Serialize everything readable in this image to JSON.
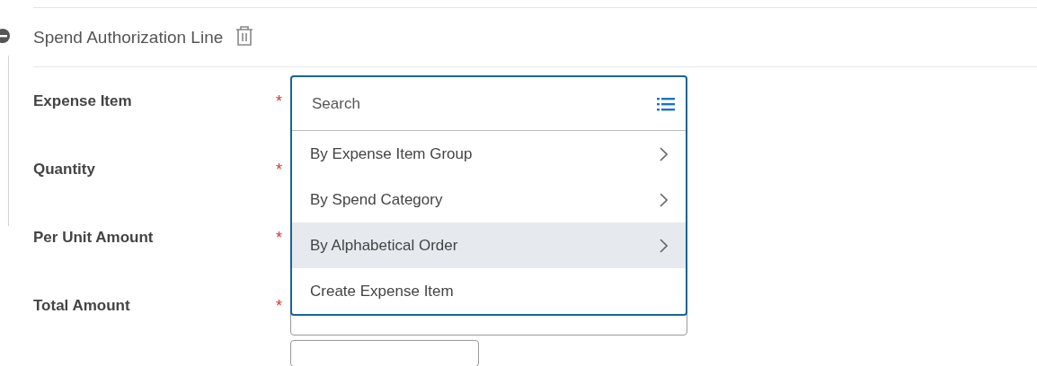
{
  "section": {
    "title": "Spend Authorization Line"
  },
  "fields": [
    {
      "label": "Expense Item",
      "required_mark": "*"
    },
    {
      "label": "Quantity",
      "required_mark": "*"
    },
    {
      "label": "Per Unit Amount",
      "required_mark": "*"
    },
    {
      "label": "Total Amount",
      "required_mark": "*"
    }
  ],
  "dropdown": {
    "placeholder": "Search",
    "options": [
      {
        "label": "By Expense Item Group",
        "has_submenu": true,
        "selected": false
      },
      {
        "label": "By Spend Category",
        "has_submenu": true,
        "selected": false
      },
      {
        "label": "By Alphabetical Order",
        "has_submenu": true,
        "selected": true
      },
      {
        "label": "Create Expense Item",
        "has_submenu": false,
        "selected": false
      }
    ]
  }
}
